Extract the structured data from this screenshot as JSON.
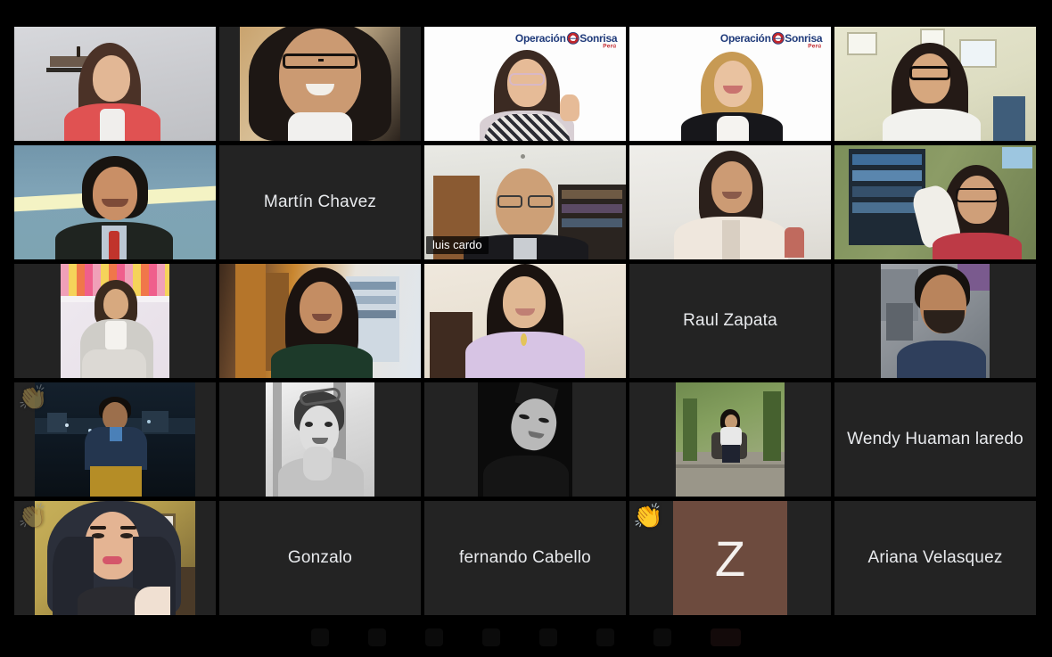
{
  "app": {
    "name": "video-conference-gallery",
    "grid": {
      "rows": 5,
      "columns": 5,
      "total_tiles": 25
    },
    "colors": {
      "background": "#000000",
      "tile_background": "#232323",
      "active_speaker_border": "#d6e34a",
      "name_text": "#e8eaed",
      "initial_avatar_background": "#6d4b3e"
    }
  },
  "branding": {
    "logo_word1": "Operación",
    "logo_word2": "Sonrisa",
    "logo_country": "Perú",
    "logo_text_color": "#1f3a7a",
    "logo_accent_color": "#c0272d"
  },
  "reactions": {
    "clap": "👏",
    "clap_label": "clapping-hands"
  },
  "participants": [
    {
      "index": 1,
      "row": 1,
      "col": 1,
      "name": "",
      "display": "video",
      "name_visible": false,
      "speaking": false,
      "reaction": null,
      "logo": false
    },
    {
      "index": 2,
      "row": 1,
      "col": 2,
      "name": "",
      "display": "photo",
      "name_visible": false,
      "speaking": false,
      "reaction": null,
      "logo": false
    },
    {
      "index": 3,
      "row": 1,
      "col": 3,
      "name": "",
      "display": "video",
      "name_visible": false,
      "speaking": false,
      "reaction": null,
      "logo": true
    },
    {
      "index": 4,
      "row": 1,
      "col": 4,
      "name": "",
      "display": "video",
      "name_visible": false,
      "speaking": false,
      "reaction": null,
      "logo": true
    },
    {
      "index": 5,
      "row": 1,
      "col": 5,
      "name": "",
      "display": "video",
      "name_visible": false,
      "speaking": false,
      "reaction": null,
      "logo": false
    },
    {
      "index": 6,
      "row": 2,
      "col": 1,
      "name": "",
      "display": "video",
      "name_visible": false,
      "speaking": false,
      "reaction": null,
      "logo": false
    },
    {
      "index": 7,
      "row": 2,
      "col": 2,
      "name": "Martín Chavez",
      "display": "name",
      "name_visible": true,
      "speaking": false,
      "reaction": null,
      "logo": false
    },
    {
      "index": 8,
      "row": 2,
      "col": 3,
      "name": "luis cardo",
      "display": "video",
      "name_visible": true,
      "speaking": true,
      "reaction": null,
      "logo": false
    },
    {
      "index": 9,
      "row": 2,
      "col": 4,
      "name": "",
      "display": "video",
      "name_visible": false,
      "speaking": false,
      "reaction": null,
      "logo": false
    },
    {
      "index": 10,
      "row": 2,
      "col": 5,
      "name": "",
      "display": "video",
      "name_visible": false,
      "speaking": false,
      "reaction": null,
      "logo": false
    },
    {
      "index": 11,
      "row": 3,
      "col": 1,
      "name": "",
      "display": "photo",
      "name_visible": false,
      "speaking": false,
      "reaction": null,
      "logo": false
    },
    {
      "index": 12,
      "row": 3,
      "col": 2,
      "name": "",
      "display": "video",
      "name_visible": false,
      "speaking": false,
      "reaction": null,
      "logo": false
    },
    {
      "index": 13,
      "row": 3,
      "col": 3,
      "name": "",
      "display": "video",
      "name_visible": false,
      "speaking": false,
      "reaction": null,
      "logo": false
    },
    {
      "index": 14,
      "row": 3,
      "col": 4,
      "name": "Raul Zapata",
      "display": "name",
      "name_visible": true,
      "speaking": false,
      "reaction": null,
      "logo": false
    },
    {
      "index": 15,
      "row": 3,
      "col": 5,
      "name": "",
      "display": "photo",
      "name_visible": false,
      "speaking": false,
      "reaction": null,
      "logo": false
    },
    {
      "index": 16,
      "row": 4,
      "col": 1,
      "name": "",
      "display": "photo",
      "name_visible": false,
      "speaking": false,
      "reaction": "clap",
      "reaction_dim": true,
      "logo": false
    },
    {
      "index": 17,
      "row": 4,
      "col": 2,
      "name": "",
      "display": "photo",
      "name_visible": false,
      "speaking": false,
      "reaction": null,
      "logo": false
    },
    {
      "index": 18,
      "row": 4,
      "col": 3,
      "name": "",
      "display": "photo",
      "name_visible": false,
      "speaking": false,
      "reaction": null,
      "logo": false
    },
    {
      "index": 19,
      "row": 4,
      "col": 4,
      "name": "",
      "display": "photo",
      "name_visible": false,
      "speaking": false,
      "reaction": null,
      "logo": false
    },
    {
      "index": 20,
      "row": 4,
      "col": 5,
      "name": "Wendy Huaman laredo",
      "display": "name",
      "name_visible": true,
      "speaking": false,
      "reaction": null,
      "logo": false
    },
    {
      "index": 21,
      "row": 5,
      "col": 1,
      "name": "",
      "display": "photo",
      "name_visible": false,
      "speaking": false,
      "reaction": "clap",
      "reaction_dim": true,
      "logo": false
    },
    {
      "index": 22,
      "row": 5,
      "col": 2,
      "name": "Gonzalo",
      "display": "name",
      "name_visible": true,
      "speaking": false,
      "reaction": null,
      "logo": false
    },
    {
      "index": 23,
      "row": 5,
      "col": 3,
      "name": "fernando Cabello",
      "display": "name",
      "name_visible": true,
      "speaking": false,
      "reaction": null,
      "logo": false
    },
    {
      "index": 24,
      "row": 5,
      "col": 4,
      "name": "",
      "display": "initial",
      "initial": "Z",
      "name_visible": false,
      "speaking": false,
      "reaction": "clap",
      "reaction_dim": false,
      "logo": false
    },
    {
      "index": 25,
      "row": 5,
      "col": 5,
      "name": "Ariana Velasquez",
      "display": "name",
      "name_visible": true,
      "speaking": false,
      "reaction": null,
      "logo": false
    }
  ],
  "toolbar": {
    "visible": true,
    "buttons": [
      "microphone",
      "camera",
      "share-screen",
      "reactions",
      "participants",
      "chat",
      "more",
      "end-call"
    ]
  }
}
